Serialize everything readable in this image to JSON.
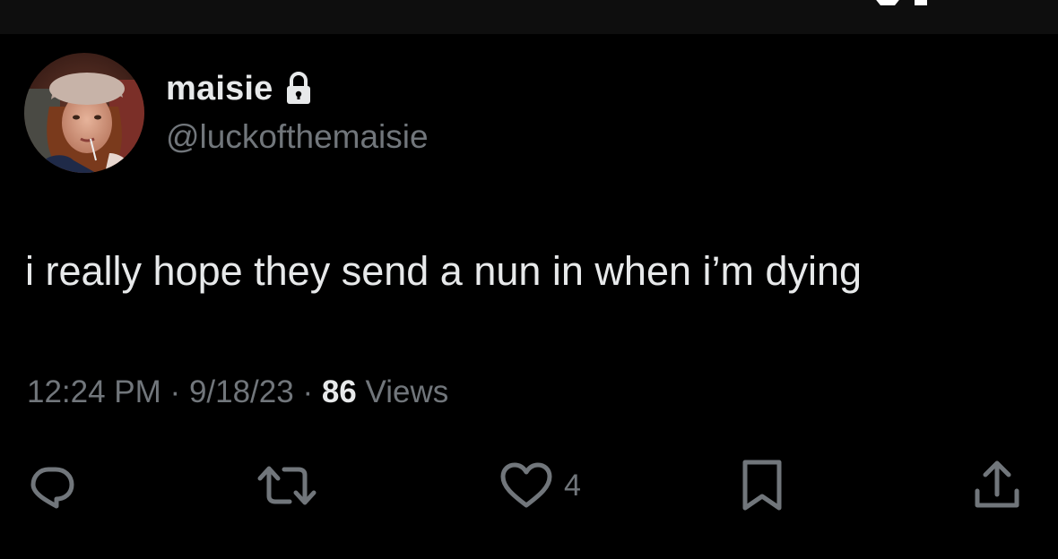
{
  "author": {
    "display_name": "maisie",
    "handle": "@luckofthemaisie",
    "protected_icon": "lock-icon",
    "avatar_icon": "profile-photo"
  },
  "tweet": {
    "text": "i really hope they send a nun in when i’m dying",
    "time": "12:24 PM",
    "date": "9/18/23",
    "separator": "·",
    "views_count": "86",
    "views_label": "Views"
  },
  "actions": {
    "reply_icon": "reply-icon",
    "retweet_icon": "retweet-icon",
    "like_icon": "heart-icon",
    "like_count": "4",
    "bookmark_icon": "bookmark-icon",
    "share_icon": "share-icon"
  },
  "colors": {
    "background": "#000000",
    "text_primary": "#e7e9ea",
    "text_secondary": "#71767b",
    "top_bar": "#0e0e0e"
  }
}
